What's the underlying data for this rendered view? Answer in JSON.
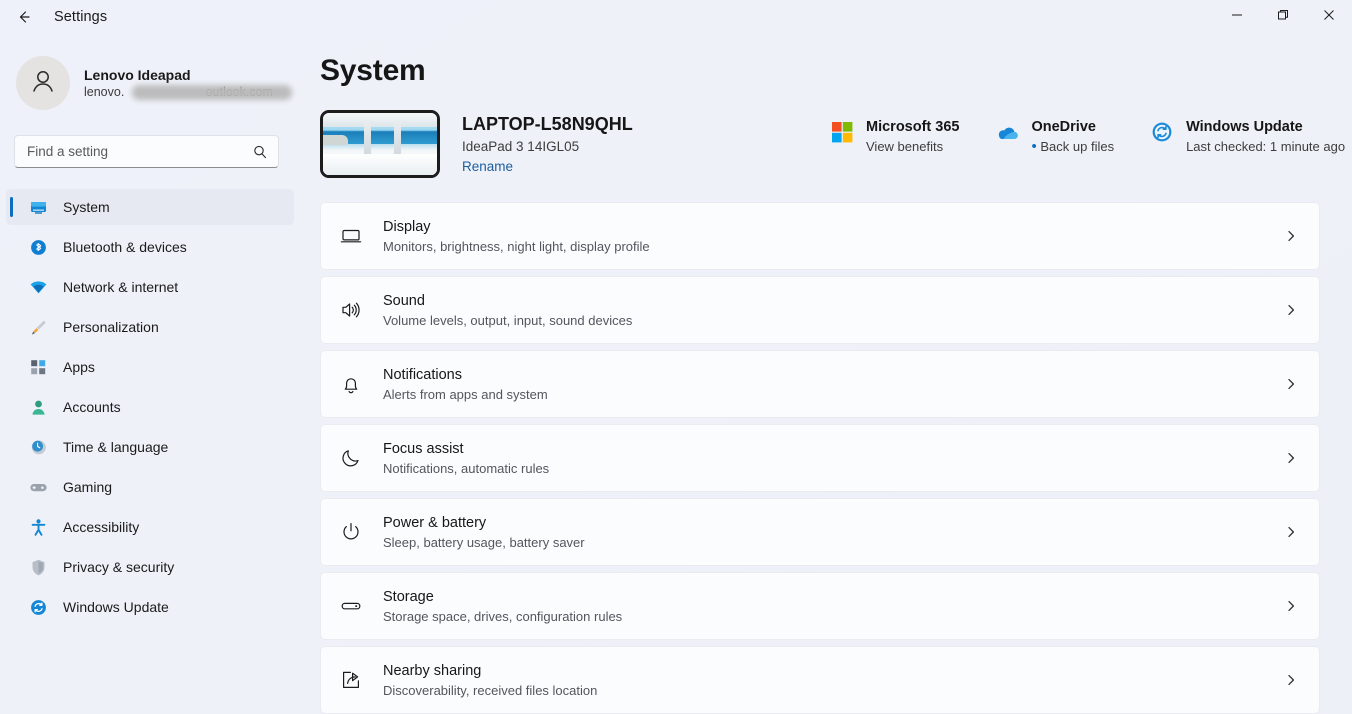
{
  "window": {
    "title": "Settings",
    "back_icon": "back-arrow-icon",
    "minimize_label": "Minimize",
    "maximize_label": "Restore",
    "close_label": "Close"
  },
  "sidebar": {
    "account": {
      "name": "Lenovo Ideapad",
      "email_prefix": "lenovo.",
      "email_suffix": "outlook.com",
      "avatar_icon": "person-icon"
    },
    "search": {
      "placeholder": "Find a setting",
      "value": "",
      "icon": "search-icon"
    },
    "items": [
      {
        "label": "System",
        "icon": "system-monitor-icon",
        "selected": true
      },
      {
        "label": "Bluetooth & devices",
        "icon": "bluetooth-icon",
        "selected": false
      },
      {
        "label": "Network & internet",
        "icon": "wifi-icon",
        "selected": false
      },
      {
        "label": "Personalization",
        "icon": "paintbrush-icon",
        "selected": false
      },
      {
        "label": "Apps",
        "icon": "apps-grid-icon",
        "selected": false
      },
      {
        "label": "Accounts",
        "icon": "accounts-person-icon",
        "selected": false
      },
      {
        "label": "Time & language",
        "icon": "clock-globe-icon",
        "selected": false
      },
      {
        "label": "Gaming",
        "icon": "gamepad-icon",
        "selected": false
      },
      {
        "label": "Accessibility",
        "icon": "accessibility-person-icon",
        "selected": false
      },
      {
        "label": "Privacy & security",
        "icon": "shield-icon",
        "selected": false
      },
      {
        "label": "Windows Update",
        "icon": "update-refresh-icon",
        "selected": false
      }
    ]
  },
  "main": {
    "page_title": "System",
    "device": {
      "name": "LAPTOP-L58N9QHL",
      "model": "IdeaPad 3 14IGL05",
      "rename_label": "Rename",
      "thumb_icon": "desktop-wallpaper-thumbnail"
    },
    "quicklinks": [
      {
        "title": "Microsoft 365",
        "subtitle": "View benefits",
        "icon": "microsoft-logo-icon",
        "has_dot": false
      },
      {
        "title": "OneDrive",
        "subtitle": "Back up files",
        "icon": "onedrive-cloud-icon",
        "has_dot": true
      },
      {
        "title": "Windows Update",
        "subtitle": "Last checked: 1 minute ago",
        "icon": "windows-update-icon",
        "has_dot": false
      }
    ],
    "settings_rows": [
      {
        "title": "Display",
        "subtitle": "Monitors, brightness, night light, display profile",
        "icon": "display-monitor-icon",
        "chevron": "chevron-right-icon"
      },
      {
        "title": "Sound",
        "subtitle": "Volume levels, output, input, sound devices",
        "icon": "speaker-sound-icon",
        "chevron": "chevron-right-icon"
      },
      {
        "title": "Notifications",
        "subtitle": "Alerts from apps and system",
        "icon": "bell-icon",
        "chevron": "chevron-right-icon"
      },
      {
        "title": "Focus assist",
        "subtitle": "Notifications, automatic rules",
        "icon": "moon-icon",
        "chevron": "chevron-right-icon"
      },
      {
        "title": "Power & battery",
        "subtitle": "Sleep, battery usage, battery saver",
        "icon": "power-icon",
        "chevron": "chevron-right-icon"
      },
      {
        "title": "Storage",
        "subtitle": "Storage space, drives, configuration rules",
        "icon": "storage-drive-icon",
        "chevron": "chevron-right-icon"
      },
      {
        "title": "Nearby sharing",
        "subtitle": "Discoverability, received files location",
        "icon": "share-icon",
        "chevron": "chevron-right-icon"
      }
    ]
  },
  "colors": {
    "accent": "#0d6ebe",
    "page_background": "#eef1f8",
    "card_background": "#fbfcfe",
    "link": "#1d5e9e",
    "selection_indicator": "#0d6ebe"
  }
}
